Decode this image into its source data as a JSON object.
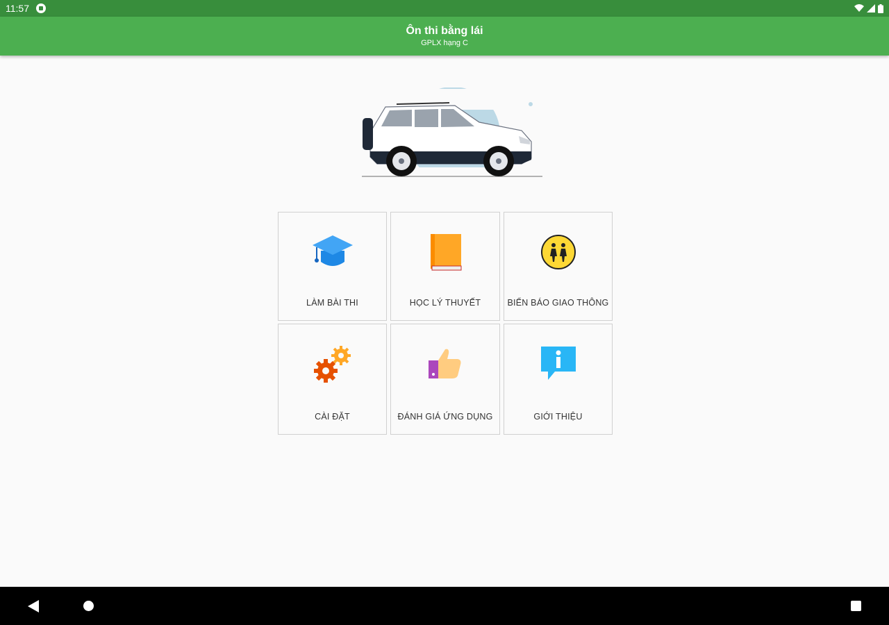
{
  "status_bar": {
    "time": "11:57"
  },
  "app_bar": {
    "title": "Ôn thi bằng lái",
    "subtitle": "GPLX hạng C"
  },
  "colors": {
    "primary": "#4caf50",
    "primary_dark": "#388e3c"
  },
  "menu": {
    "items": [
      {
        "label": "LÀM BÀI THI",
        "icon": "graduation-cap-icon"
      },
      {
        "label": "HỌC LÝ THUYẾT",
        "icon": "book-icon"
      },
      {
        "label": "BIỂN BÁO GIAO THÔNG",
        "icon": "traffic-sign-icon"
      },
      {
        "label": "CÀI ĐẶT",
        "icon": "gears-icon"
      },
      {
        "label": "ĐÁNH GIÁ ỨNG DỤNG",
        "icon": "thumbs-up-icon"
      },
      {
        "label": "GIỚI THIỆU",
        "icon": "info-icon"
      }
    ]
  }
}
